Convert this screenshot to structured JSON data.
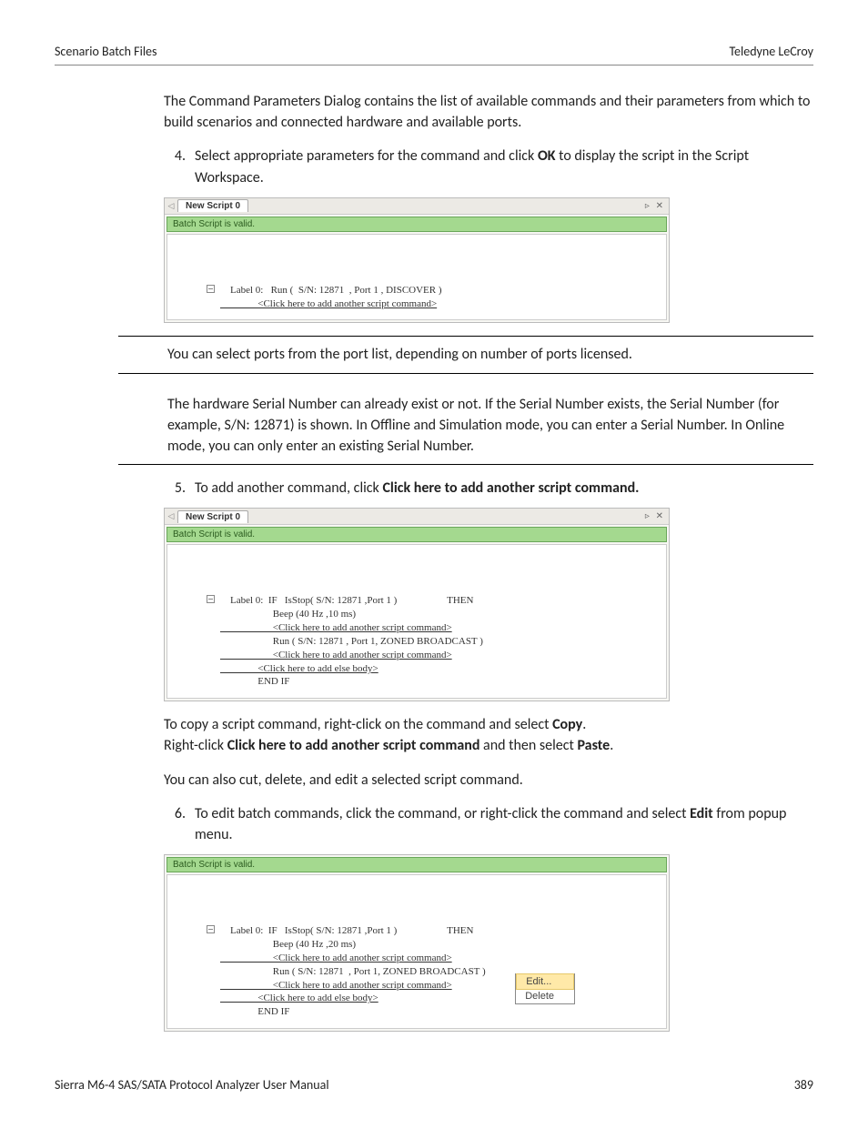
{
  "header": {
    "left": "Scenario Batch Files",
    "right": "Teledyne LeCroy"
  },
  "footer": {
    "left": "Sierra M6-4 SAS/SATA Protocol Analyzer User Manual",
    "right": "389"
  },
  "intro": "The Command Parameters Dialog contains the list of available commands and their parameters from which to build scenarios and connected hardware and available ports.",
  "step4": {
    "num": "4.",
    "pre": "Select appropriate parameters for the command and click ",
    "bold": "OK",
    "post": " to display the script in the Script Workspace."
  },
  "note1": "You can select ports from the port list, depending on number of ports licensed.",
  "note2": "The hardware Serial Number can already exist or not. If the Serial Number exists, the Serial Number (for example, S/N: 12871) is shown. In Offline and Simulation mode, you can enter a Serial Number. In Online mode, you can only enter an existing Serial Number.",
  "step5": {
    "num": "5.",
    "pre": "To add another command, click ",
    "bold": "Click here to add another script command."
  },
  "copy": {
    "pre": "To copy a script command, right-click on the command and select ",
    "bold": "Copy",
    "post": "."
  },
  "paste": {
    "pre": "Right-click ",
    "bold1": "Click here to add another script command",
    "mid": " and then select ",
    "bold2": "Paste",
    "post": "."
  },
  "cutline": "You can also cut, delete, and edit a selected script command.",
  "step6": {
    "num": "6.",
    "pre": "To edit batch commands, click the command, or right-click the command and select ",
    "bold": "Edit",
    "post": " from popup menu."
  },
  "shot_common": {
    "tab_title": "New Script 0",
    "valid_text": "Batch Script is valid.",
    "close_glyph": "▹ ✕",
    "arrow_glyph": "◁"
  },
  "shot1": {
    "l1": "    Label 0:   Run (  S/N: 12871  , Port 1 , DISCOVER )",
    "l2": "               <Click here to add another script command>"
  },
  "shot2": {
    "l1": "    Label 0:  IF   IsStop( S/N: 12871 ,Port 1 )                    THEN",
    "l2": "                     Beep (40 Hz ,10 ms)",
    "l3": "                     <Click here to add another script command>",
    "l4": "                     Run ( S/N: 12871 , Port 1, ZONED BROADCAST )",
    "l5": "                     <Click here to add another script command>",
    "l6": "               <Click here to add else body>",
    "l7": "               END IF"
  },
  "shot3": {
    "l1": "    Label 0:  IF   IsStop( S/N: 12871 ,Port 1 )                    THEN",
    "l2": "                     Beep (40 Hz ,20 ms)",
    "l3": "                     <Click here to add another script command>",
    "l4": "                     Run ( S/N: 12871  , Port 1, ZONED BROADCAST )",
    "l5": "                     <Click here to add another script command>",
    "l6": "               <Click here to add else body>",
    "l7": "               END IF",
    "menu_edit": "Edit...",
    "menu_delete": "Delete"
  }
}
